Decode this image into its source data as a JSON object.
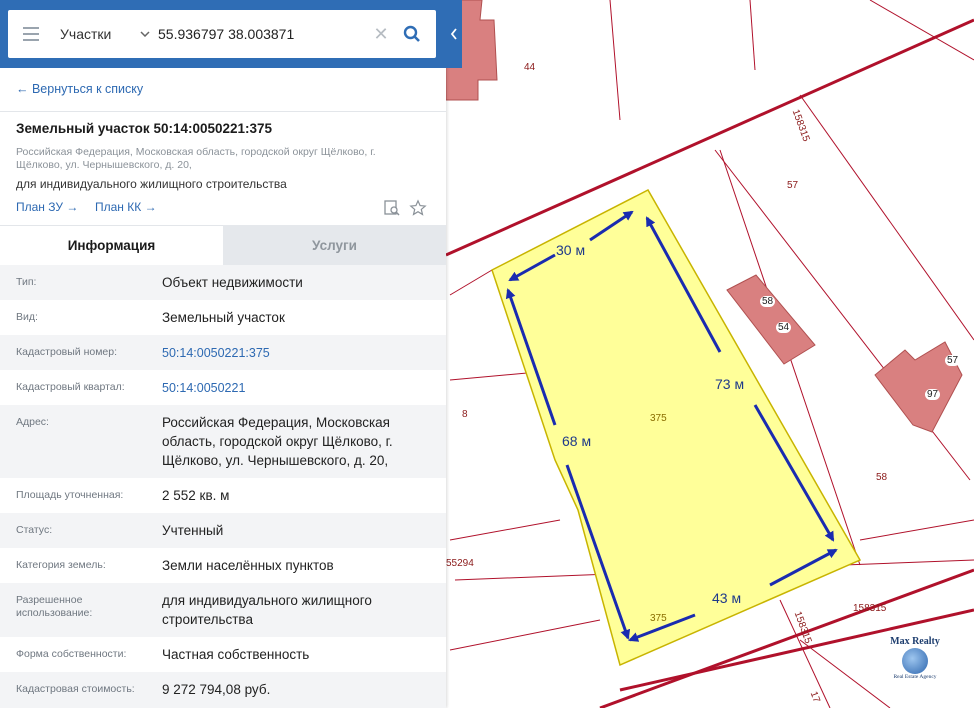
{
  "search": {
    "type_label": "Участки",
    "query": "55.936797 38.003871",
    "clear_glyph": "✕"
  },
  "back_link": "← Вернуться к списку",
  "parcel": {
    "title": "Земельный участок 50:14:0050221:375",
    "address": "Российская Федерация, Московская область, городской округ Щёлково, г. Щёлково, ул. Чернышевского, д. 20,",
    "use": "для индивидуального жилищного строительства",
    "plan_zu": "План ЗУ →",
    "plan_kk": "План КК →"
  },
  "tabs": {
    "info": "Информация",
    "services": "Услуги"
  },
  "info": [
    {
      "label": "Тип:",
      "value": "Объект недвижимости"
    },
    {
      "label": "Вид:",
      "value": "Земельный участок"
    },
    {
      "label": "Кадастровый номер:",
      "value": "50:14:0050221:375"
    },
    {
      "label": "Кадастровый квартал:",
      "value": "50:14:0050221"
    },
    {
      "label": "Адрес:",
      "value": "Российская Федерация, Московская область, городской округ Щёлково, г. Щёлково, ул. Чернышевского, д. 20,"
    },
    {
      "label": "Площадь уточненная:",
      "value": "2 552 кв. м"
    },
    {
      "label": "Статус:",
      "value": "Учтенный"
    },
    {
      "label": "Категория земель:",
      "value": "Земли населённых пунктов"
    },
    {
      "label": "Разрешенное использование:",
      "value": "для индивидуального жилищного строительства"
    },
    {
      "label": "Форма собственности:",
      "value": "Частная собственность"
    },
    {
      "label": "Кадастровая стоимость:",
      "value": "9 272 794,08 руб."
    }
  ],
  "map": {
    "measurements": {
      "top": "30 м",
      "right": "73 м",
      "left": "68 м",
      "bottom": "43 м"
    },
    "labels": {
      "l44": "44",
      "l158315a": "158315",
      "l57a": "57",
      "l58a": "58",
      "l54": "54",
      "l57b": "57",
      "l97": "97",
      "l8": "8",
      "l375a": "375",
      "l58b": "58",
      "l55294": "55294",
      "l158315b": "158315",
      "l375b": "375",
      "l158315c": "158315",
      "l17": "17"
    },
    "watermark": {
      "title": "Max Realty",
      "subtitle": "Real Estate Agency"
    },
    "colors": {
      "parcel_fill": "#ffff99",
      "parcel_stroke": "#c8b400",
      "boundary": "#b0112b",
      "building": "#d98080",
      "arrow": "#1a2bb0"
    }
  }
}
